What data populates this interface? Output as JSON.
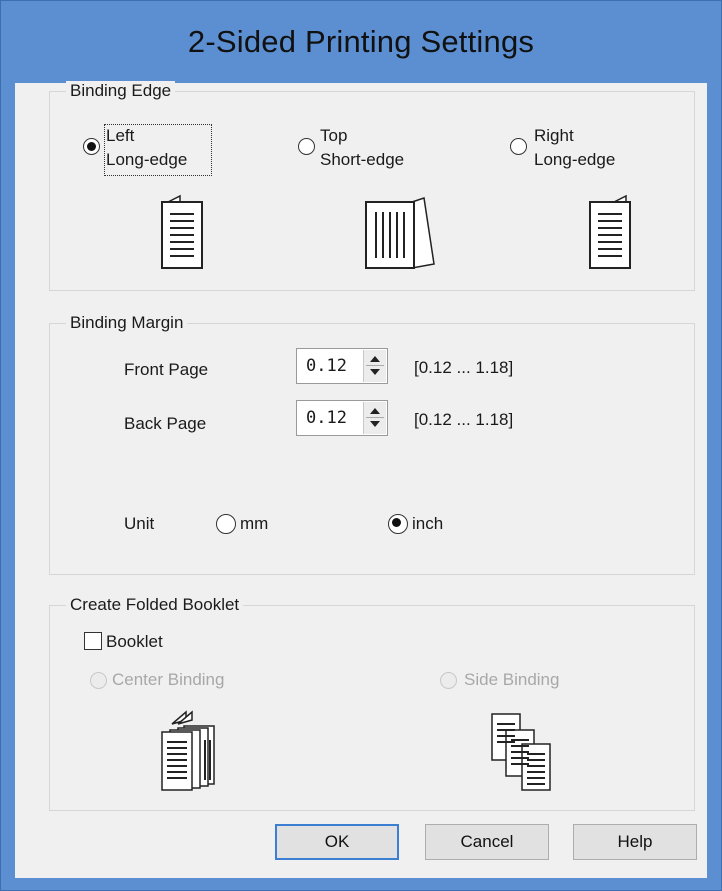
{
  "window": {
    "title": "2-Sided Printing Settings",
    "accent": "#5b8fd1"
  },
  "binding_edge": {
    "group_label": "Binding Edge",
    "options": [
      {
        "line1": "Left",
        "line2": "Long-edge",
        "selected": true,
        "icon": "left-bound-page-icon"
      },
      {
        "line1": "Top",
        "line2": "Short-edge",
        "selected": false,
        "icon": "top-bound-page-icon"
      },
      {
        "line1": "Right",
        "line2": "Long-edge",
        "selected": false,
        "icon": "right-bound-page-icon"
      }
    ]
  },
  "binding_margin": {
    "group_label": "Binding Margin",
    "front_page": {
      "label": "Front Page",
      "value": "0.12",
      "range": "[0.12 ... 1.18]"
    },
    "back_page": {
      "label": "Back Page",
      "value": "0.12",
      "range": "[0.12 ... 1.18]"
    },
    "unit": {
      "label": "Unit",
      "options": [
        {
          "label": "mm",
          "selected": false
        },
        {
          "label": "inch",
          "selected": true
        }
      ]
    }
  },
  "booklet": {
    "group_label": "Create Folded Booklet",
    "checkbox_label": "Booklet",
    "checked": false,
    "options": [
      {
        "label": "Center Binding",
        "enabled": false,
        "icon": "center-binding-booklet-icon"
      },
      {
        "label": "Side Binding",
        "enabled": false,
        "icon": "side-binding-booklet-icon"
      }
    ]
  },
  "buttons": {
    "ok": "OK",
    "cancel": "Cancel",
    "help": "Help"
  }
}
